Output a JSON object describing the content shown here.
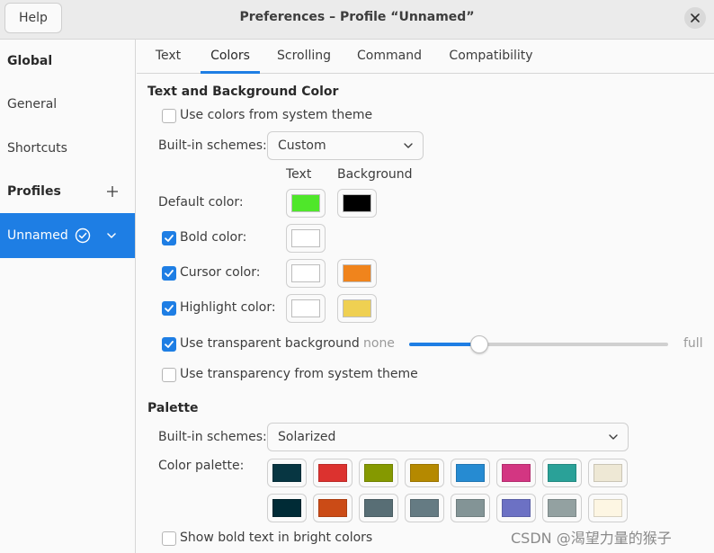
{
  "header": {
    "help_label": "Help",
    "title": "Preferences – Profile “Unnamed”",
    "close_icon": "close-icon"
  },
  "sidebar": {
    "global_heading": "Global",
    "items": [
      {
        "label": "General"
      },
      {
        "label": "Shortcuts"
      }
    ],
    "profiles_heading": "Profiles",
    "profile": {
      "label": "Unnamed",
      "is_default": true
    }
  },
  "tabs": [
    {
      "label": "Text",
      "active": false
    },
    {
      "label": "Colors",
      "active": true
    },
    {
      "label": "Scrolling",
      "active": false
    },
    {
      "label": "Command",
      "active": false
    },
    {
      "label": "Compatibility",
      "active": false
    }
  ],
  "text_bg": {
    "heading": "Text and Background Color",
    "use_system_colors": {
      "label": "Use colors from system theme",
      "checked": false
    },
    "builtin_label": "Built-in schemes:",
    "builtin_value": "Custom",
    "col_text": "Text",
    "col_background": "Background",
    "default_color": {
      "label": "Default color:",
      "text": "#4fe72a",
      "background": "#000000"
    },
    "bold_color": {
      "label": "Bold color:",
      "checked": true,
      "text": "#ffffff"
    },
    "cursor_color": {
      "label": "Cursor color:",
      "checked": true,
      "text": "#ffffff",
      "background": "#f0841c"
    },
    "highlight_color": {
      "label": "Highlight color:",
      "checked": true,
      "text": "#ffffff",
      "background": "#efd052"
    },
    "transparent_bg": {
      "label": "Use transparent background",
      "checked": true,
      "min_label": "none",
      "max_label": "full",
      "level": 0.27
    },
    "system_transparency": {
      "label": "Use transparency from system theme",
      "checked": false
    }
  },
  "palette": {
    "heading": "Palette",
    "builtin_label": "Built-in schemes:",
    "builtin_value": "Solarized",
    "palette_label": "Color palette:",
    "row1": [
      "#073642",
      "#dc322f",
      "#859900",
      "#b58900",
      "#268bd2",
      "#d33682",
      "#2aa198",
      "#eee8d5"
    ],
    "row2": [
      "#002b36",
      "#cb4b16",
      "#586e75",
      "#657b83",
      "#839496",
      "#6c71c4",
      "#93a1a1",
      "#fdf6e3"
    ],
    "bold_bright": {
      "label": "Show bold text in bright colors",
      "checked": false
    }
  },
  "watermark": "CSDN @渴望力量的猴子"
}
